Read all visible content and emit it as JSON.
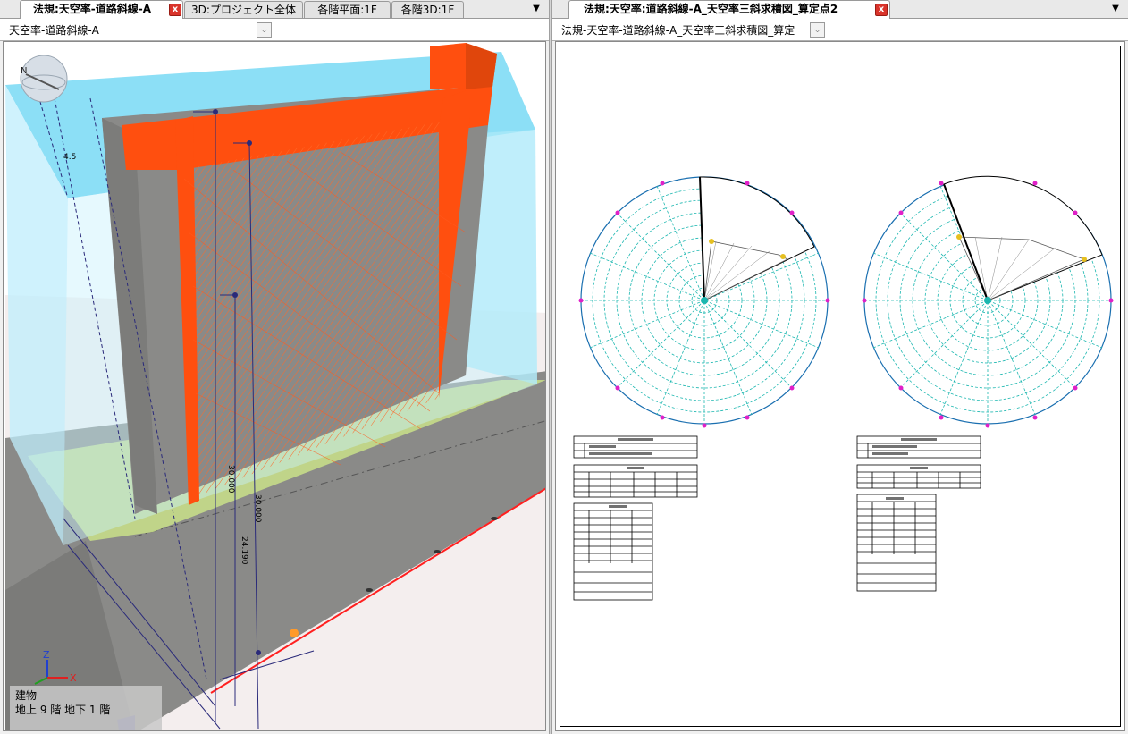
{
  "left": {
    "tabs": [
      {
        "label": "法規:天空率-道路斜線-A",
        "active": true,
        "close": "x"
      },
      {
        "label": "3D:プロジェクト全体",
        "active": false
      },
      {
        "label": "各階平面:1F",
        "active": false
      },
      {
        "label": "各階3D:1F",
        "active": false
      }
    ],
    "menu_icon": "▼",
    "view_name": "天空率-道路斜線-A",
    "combo_arrow": "⌵",
    "compass_label": "N",
    "dims": [
      "30.000",
      "30.000",
      "24.190",
      "4.5"
    ],
    "axes": {
      "x": "X",
      "z": "Z"
    },
    "status": {
      "line1": "建物",
      "line2": "地上 9 階  地下 1 階"
    }
  },
  "right": {
    "tab": {
      "label": "法規:天空率:道路斜線-A_天空率三斜求積図_算定点2",
      "close": "x"
    },
    "menu_icon": "▼",
    "view_name": "法規-天空率-道路斜線-A_天空率三斜求積図_算定",
    "combo_arrow": "⌵"
  },
  "colors": {
    "sky": "#7fdcf5",
    "building": "#ff4f0f",
    "grey": "#8a8a88",
    "grid": "#1cb7b0",
    "road_line": "#ff2020",
    "marker": "#e020c8"
  }
}
